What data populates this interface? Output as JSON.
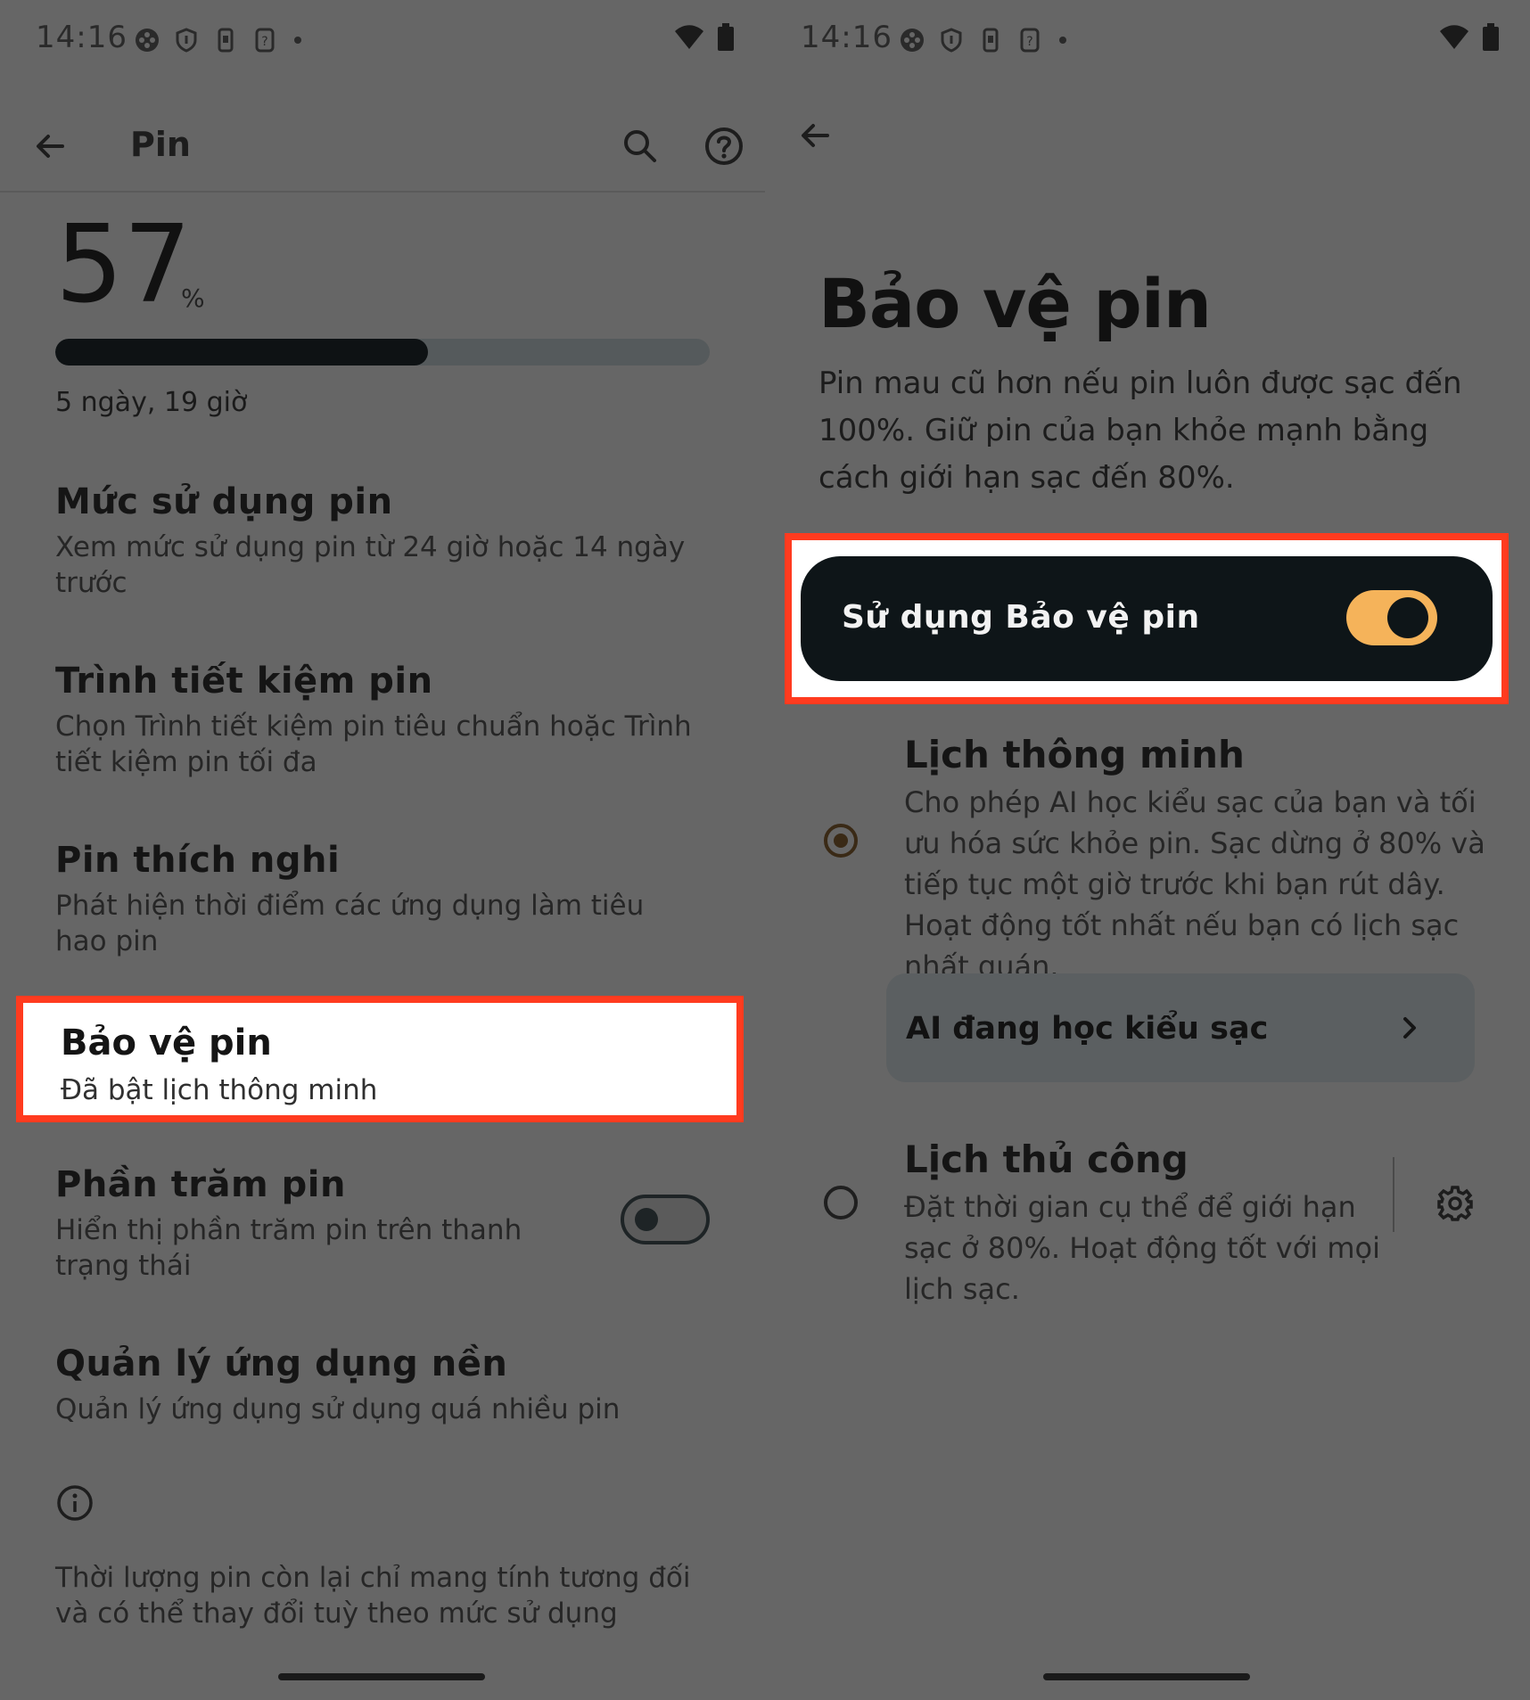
{
  "left": {
    "status": {
      "time": "14:16"
    },
    "appbar": {
      "title": "Pin"
    },
    "battery": {
      "percent": "57",
      "unit": "%",
      "level": 0.57,
      "remaining": "5 ngày, 19 giờ"
    },
    "items": [
      {
        "title": "Mức sử dụng pin",
        "subtitle": "Xem mức sử dụng pin từ 24 giờ hoặc 14 ngày trước"
      },
      {
        "title": "Trình tiết kiệm pin",
        "subtitle": "Chọn Trình tiết kiệm pin tiêu chuẩn hoặc Trình tiết kiệm pin tối đa"
      },
      {
        "title": "Pin thích nghi",
        "subtitle": "Phát hiện thời điểm các ứng dụng làm tiêu hao pin"
      },
      {
        "title": "Bảo vệ pin",
        "subtitle": "Đã bật lịch thông minh"
      },
      {
        "title": "Phần trăm pin",
        "subtitle": "Hiển thị phần trăm pin trên thanh trạng thái"
      },
      {
        "title": "Quản lý ứng dụng nền",
        "subtitle": "Quản lý ứng dụng sử dụng quá nhiều pin"
      }
    ],
    "footnote": "Thời lượng pin còn lại chỉ mang tính tương đối và có thể thay đổi tuỳ theo mức sử dụng"
  },
  "right": {
    "status": {
      "time": "14:16"
    },
    "title": "Bảo vệ pin",
    "description": "Pin mau cũ hơn nếu pin luôn được sạc đến 100%. Giữ pin của bạn khỏe mạnh bằng cách giới hạn sạc đến 80%.",
    "master_toggle": {
      "label": "Sử dụng Bảo vệ pin",
      "on": true
    },
    "options": [
      {
        "title": "Lịch thông minh",
        "subtitle": "Cho phép AI học kiểu sạc của bạn và tối ưu hóa sức khỏe pin. Sạc dừng ở 80% và tiếp tục một giờ trước khi bạn rút dây. Hoạt động tốt nhất nếu bạn có lịch sạc nhất quán.",
        "selected": true
      },
      {
        "title": "Lịch thủ công",
        "subtitle": "Đặt thời gian cụ thể để giới hạn sạc ở 80%. Hoạt động tốt với mọi lịch sạc.",
        "selected": false
      }
    ],
    "ai_card": {
      "label": "AI đang học kiểu sạc"
    }
  },
  "colors": {
    "highlight": "#ff3b1f",
    "toggle_on": "#f5b35a",
    "background": "#666666"
  }
}
